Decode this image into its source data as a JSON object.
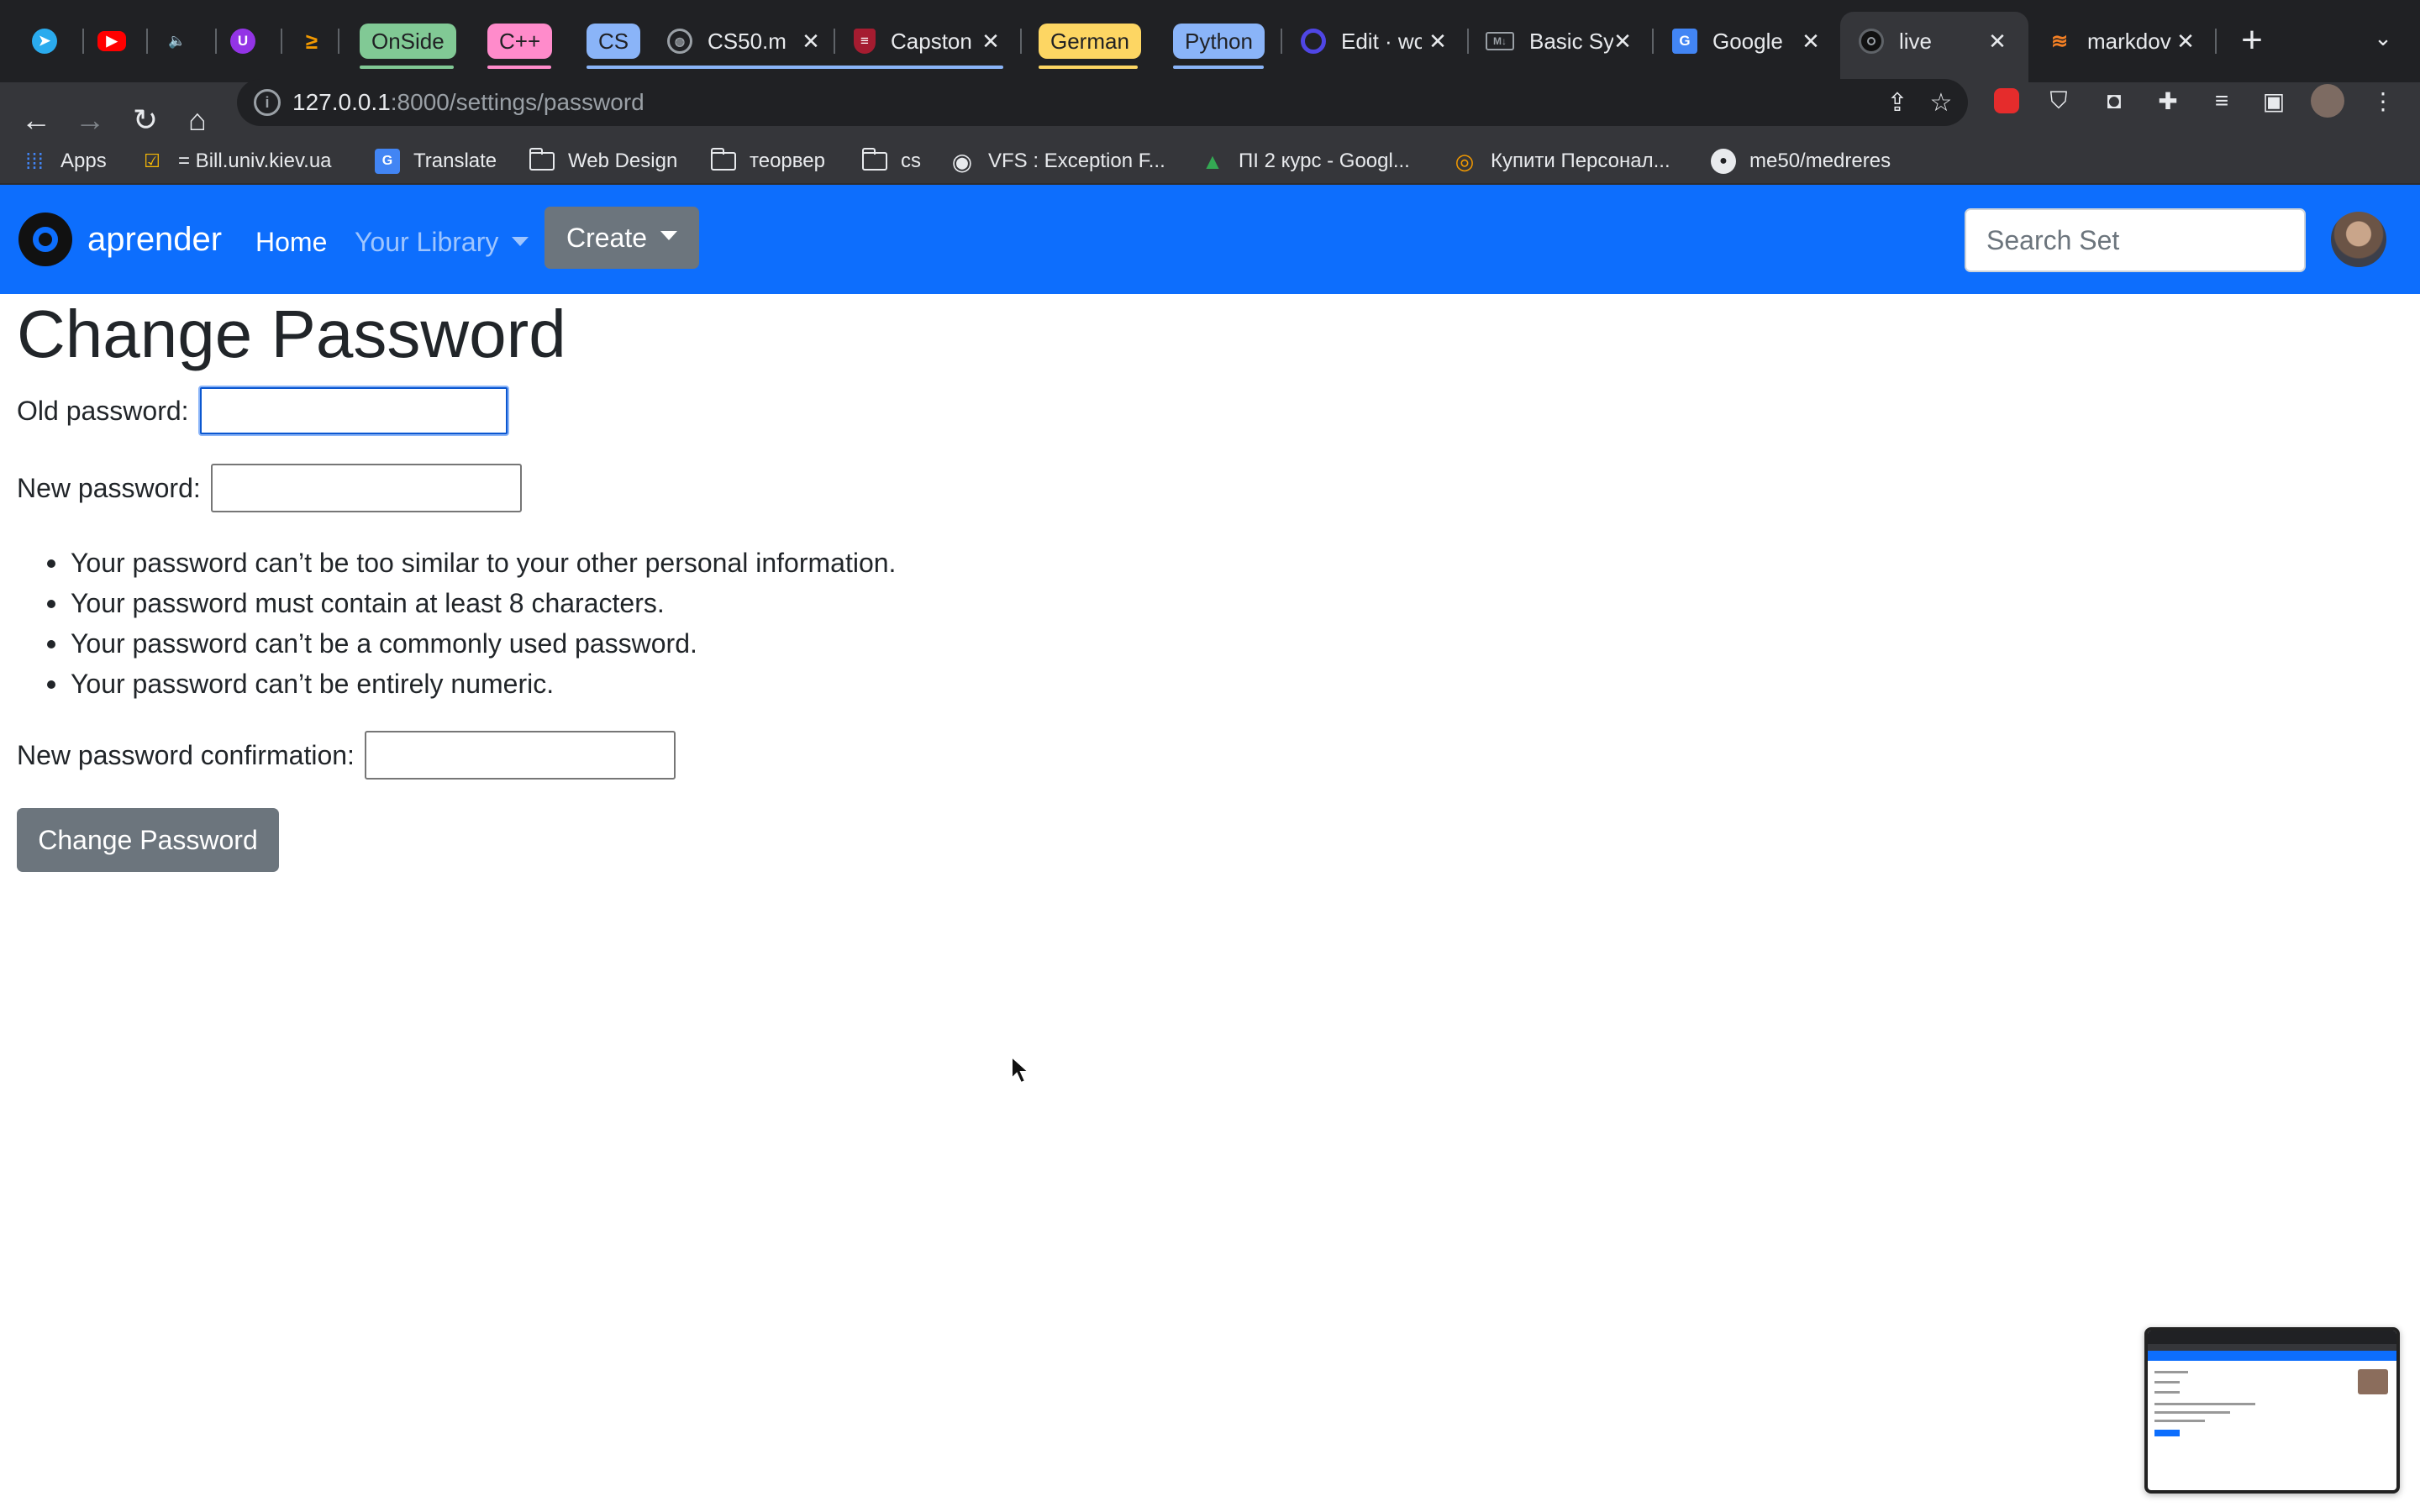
{
  "browser": {
    "tabs": [
      {
        "title": "",
        "icon": "telegram-icon",
        "color": "#2AABEE"
      },
      {
        "title": "",
        "icon": "youtube-icon",
        "color": "#FF0000"
      },
      {
        "title": "",
        "icon": "speaker-icon",
        "color": "#e8eaed"
      },
      {
        "title": "",
        "icon": "u-icon",
        "color": "#9334E6"
      },
      {
        "title": "",
        "icon": "arrow-icon",
        "color": "#F29900"
      },
      {
        "title": "CS50.m",
        "icon": "globe-icon",
        "color": "#9aa0a6"
      },
      {
        "title": "Capston",
        "icon": "harvard-shield-icon",
        "color": "#A51C30"
      },
      {
        "title": "Edit · wc",
        "icon": "q-icon",
        "color": "#4f46e5"
      },
      {
        "title": "Basic Sy",
        "icon": "markdown-icon",
        "color": "#9aa0a6"
      },
      {
        "title": "Google",
        "icon": "google-translate-icon",
        "color": "#4285F4"
      },
      {
        "title": "live",
        "icon": "aprender-icon",
        "color": "#111111",
        "active": true
      },
      {
        "title": "markdov",
        "icon": "stackoverflow-icon",
        "color": "#F48024"
      }
    ],
    "groups": [
      {
        "label": "OnSide",
        "color": "#81c995"
      },
      {
        "label": "C++",
        "color": "#ff8bcb"
      },
      {
        "label": "CS",
        "color": "#8ab4f8"
      },
      {
        "label": "German",
        "color": "#fdd663"
      },
      {
        "label": "Python",
        "color": "#8ab4f8"
      }
    ],
    "url_host": "127.0.0.1",
    "url_rest": ":8000/settings/password",
    "bookmarks": [
      {
        "label": "Apps",
        "icon": "apps-grid-icon"
      },
      {
        "label": "= Bill.univ.kiev.ua",
        "icon": "checklist-icon"
      },
      {
        "label": "Translate",
        "icon": "google-translate-icon"
      },
      {
        "label": "Web Design",
        "icon": "folder-icon"
      },
      {
        "label": "теорвер",
        "icon": "folder-icon"
      },
      {
        "label": "cs",
        "icon": "folder-icon"
      },
      {
        "label": "VFS : Exception F...",
        "icon": "globe-icon"
      },
      {
        "label": "ПІ 2 курс - Googl...",
        "icon": "google-drive-icon"
      },
      {
        "label": "Купити Персонал...",
        "icon": "fingerprint-icon"
      },
      {
        "label": "me50/medreres",
        "icon": "github-icon"
      }
    ]
  },
  "navbar": {
    "brand": "aprender",
    "home": "Home",
    "library": "Your Library",
    "create": "Create",
    "search_placeholder": "Search Set"
  },
  "page": {
    "title": "Change Password",
    "old_password_label": "Old password:",
    "new_password_label": "New password:",
    "rules": [
      "Your password can’t be too similar to your other personal information.",
      "Your password must contain at least 8 characters.",
      "Your password can’t be a commonly used password.",
      "Your password can’t be entirely numeric."
    ],
    "confirm_label": "New password confirmation:",
    "submit_label": "Change Password"
  },
  "colors": {
    "navbar": "#0d6efd",
    "button_secondary": "#6c757d",
    "chrome_dark": "#202124",
    "chrome_toolbar": "#35363a"
  }
}
